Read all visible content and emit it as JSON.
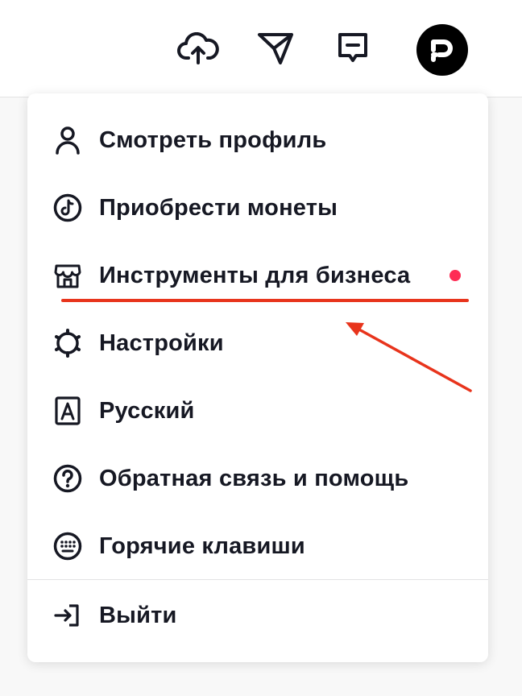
{
  "header": {
    "upload_icon": "cloud-upload-icon",
    "messages_icon": "paper-plane-icon",
    "inbox_icon": "message-box-icon",
    "avatar_icon": "avatar-logo-icon"
  },
  "menu": {
    "items": [
      {
        "label": "Смотреть профиль",
        "icon": "person-icon"
      },
      {
        "label": "Приобрести монеты",
        "icon": "tiktok-coin-icon"
      },
      {
        "label": "Инструменты для бизнеса",
        "icon": "storefront-icon",
        "badge": "new-dot"
      },
      {
        "label": "Настройки",
        "icon": "gear-icon"
      },
      {
        "label": "Русский",
        "icon": "language-a-icon"
      },
      {
        "label": "Обратная связь и помощь",
        "icon": "question-circle-icon"
      },
      {
        "label": "Горячие клавиши",
        "icon": "keyboard-icon"
      },
      {
        "label": "Выйти",
        "icon": "logout-arrow-icon"
      }
    ]
  },
  "colors": {
    "badge_dot": "#fe2c55",
    "annotation": "#e8341c",
    "text": "#161823"
  }
}
